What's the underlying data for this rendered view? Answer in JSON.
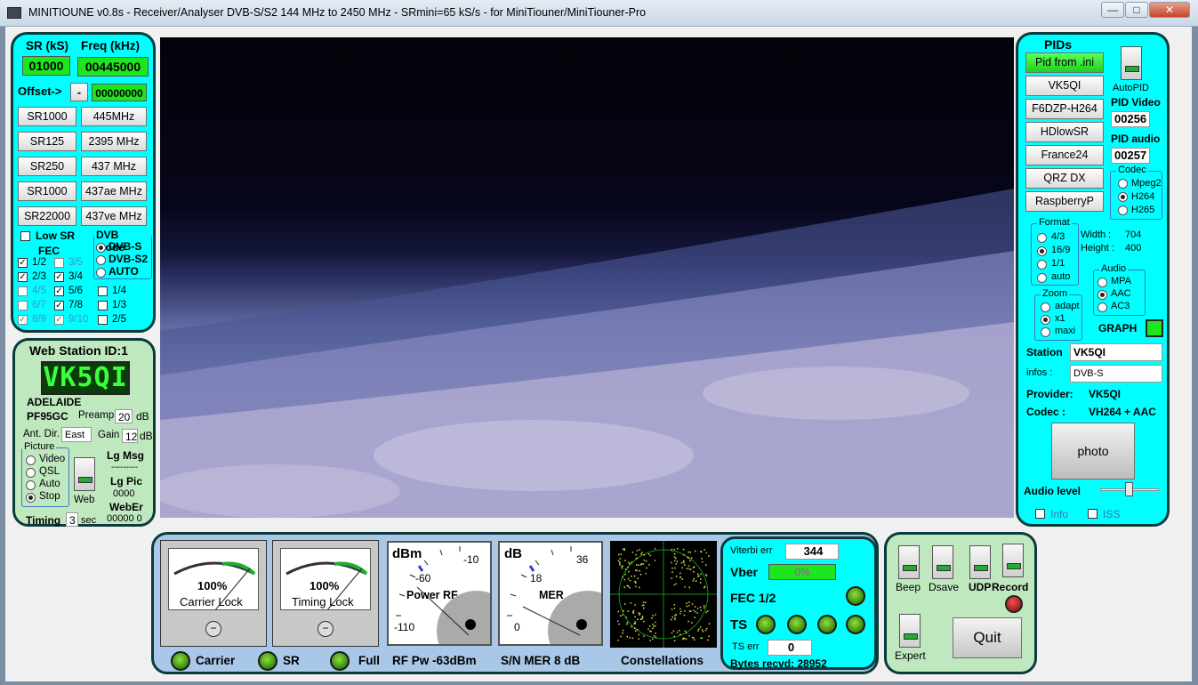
{
  "window": {
    "title": "MINITIOUNE v0.8s - Receiver/Analyser DVB-S/S2 144 MHz to 2450 MHz - SRmini=65 kS/s - for MiniTiouner/MiniTiouner-Pro",
    "min": "—",
    "max": "□",
    "close": "✕"
  },
  "tuning": {
    "sr_label": "SR (kS)",
    "freq_label": "Freq (kHz)",
    "sr_value": "01000",
    "freq_value": "00445000",
    "offset_label": "Offset->",
    "offset_sign": "-",
    "offset_value": "00000000",
    "sr_buttons": [
      "SR1000",
      "SR125",
      "SR250",
      "SR1000",
      "SR22000"
    ],
    "freq_buttons": [
      "445MHz",
      "2395 MHz",
      "437 MHz",
      "437ae MHz",
      "437ve MHz"
    ],
    "low_sr": "Low SR",
    "fec_label": "FEC",
    "dvb_mode_label": "DVB mode",
    "modes": [
      "DVB-S",
      "DVB-S2",
      "AUTO"
    ],
    "fec": [
      {
        "label": "1/2",
        "checked": true,
        "dim": false
      },
      {
        "label": "3/5",
        "checked": false,
        "dim": true
      },
      {
        "label": "2/3",
        "checked": true,
        "dim": false
      },
      {
        "label": "3/4",
        "checked": true,
        "dim": false
      },
      {
        "label": "4/5",
        "checked": false,
        "dim": true
      },
      {
        "label": "5/6",
        "checked": true,
        "dim": false
      },
      {
        "label": "1/4",
        "checked": false,
        "dim": false
      },
      {
        "label": "6/7",
        "checked": false,
        "dim": true
      },
      {
        "label": "7/8",
        "checked": true,
        "dim": false
      },
      {
        "label": "1/3",
        "checked": false,
        "dim": false
      },
      {
        "label": "8/9",
        "checked": true,
        "dim": true
      },
      {
        "label": "9/10",
        "checked": true,
        "dim": true
      },
      {
        "label": "2/5",
        "checked": false,
        "dim": false
      }
    ]
  },
  "web": {
    "title": "Web Station ID:1",
    "callsign": "VK5QI",
    "city": "ADELAIDE",
    "locator": "PF95GC",
    "preamp_label": "Preamp",
    "preamp": "20",
    "db": "dB",
    "ant_label": "Ant. Dir.",
    "ant": "East",
    "gain_label": "Gain",
    "gain": "12",
    "db2": "dB",
    "picture_label": "Picture",
    "picture_opts": [
      "Video",
      "QSL",
      "Auto",
      "Stop"
    ],
    "lg_msg": "Lg Msg",
    "dashes": "---------",
    "lg_pic": "Lg Pic",
    "lg_pic_val": "0000",
    "weber": "WebEr",
    "weber_val": "00000  0",
    "web_label": "Web",
    "timing_label": "Timing",
    "timing": "3",
    "sec": "sec"
  },
  "pids": {
    "title": "PIDs",
    "buttons": [
      "Pid from .ini",
      "VK5QI",
      "F6DZP-H264",
      "HDlowSR",
      "France24",
      "QRZ DX",
      "RaspberryP"
    ],
    "autopid": "AutoPID",
    "pid_video_label": "PID Video",
    "pid_video": "00256",
    "pid_audio_label": "PID audio",
    "pid_audio": "00257",
    "codec_label": "Codec",
    "codecs": [
      "Mpeg2",
      "H264",
      "H265"
    ],
    "format_label": "Format",
    "formats": [
      "4/3",
      "16/9",
      "1/1",
      "auto"
    ],
    "width_label": "Width :",
    "width": "704",
    "height_label": "Height :",
    "height": "400",
    "audio_label": "Audio",
    "audios": [
      "MPA",
      "AAC",
      "AC3"
    ],
    "zoom_label": "Zoom",
    "zooms": [
      "adapt",
      "x1",
      "maxi"
    ],
    "graph": "GRAPH",
    "station_label": "Station",
    "station": "VK5QI",
    "infos_label": "infos :",
    "infos": "DVB-S",
    "provider_label": "Provider:",
    "provider": "VK5QI",
    "codec_info_label": "Codec :",
    "codec_info": "VH264 + AAC",
    "photo": "photo",
    "audio_level": "Audio level",
    "info": "Info",
    "iss": "ISS"
  },
  "status": {
    "carrier_pct": "100%",
    "carrier_lock": "Carrier Lock",
    "timing_pct": "100%",
    "timing_lock": "Timing Lock",
    "dbm": "dBm",
    "rf_m10": "-10",
    "rf_m60": "-60",
    "rf_m110": "-110",
    "power_rf": "Power RF",
    "db": "dB",
    "mer_36": "36",
    "mer_18": "18",
    "mer_0": "0",
    "mer": "MER",
    "carrier": "Carrier",
    "sr": "SR",
    "full": "Full",
    "rf_pw": "RF Pw -63dBm",
    "sn_mer": "S/N MER  8 dB",
    "constellations": "Constellations",
    "carrier_level": 1.0,
    "timing_level": 1.0
  },
  "decoder": {
    "viterbi_label": "Viterbi err",
    "viterbi": "344",
    "vber_label": "Vber",
    "vber": "0%",
    "fec": "FEC 1/2",
    "ts": "TS",
    "ts_err_label": "TS err",
    "ts_err": "0",
    "bytes": "Bytes recvd:  28952"
  },
  "controls": {
    "beep": "Beep",
    "dsave": "Dsave",
    "udp": "UDP",
    "record": "Record",
    "expert": "Expert",
    "quit": "Quit"
  }
}
